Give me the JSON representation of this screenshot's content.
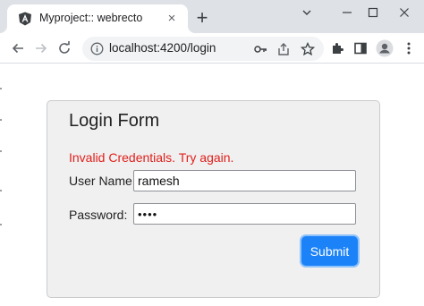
{
  "browser": {
    "tab": {
      "title": "Myproject:: webrecto",
      "close_glyph": "×"
    },
    "new_tab_glyph": "+",
    "window_controls": {
      "chevron": "⌄",
      "minimize": "—",
      "maximize": "☐",
      "close": "✕"
    },
    "omnibox": {
      "url": "localhost:4200/login"
    },
    "icons": [
      "back-icon",
      "forward-icon",
      "reload-icon",
      "info-icon",
      "key-icon",
      "share-icon",
      "star-icon",
      "extensions-icon",
      "side-panel-icon",
      "profile-icon",
      "menu-icon"
    ]
  },
  "login_form": {
    "title": "Login Form",
    "error": "Invalid Credentials. Try again.",
    "username_label": "User Name:",
    "username_value": "ramesh",
    "password_label": "Password:",
    "password_value": "••••",
    "submit_label": "Submit"
  },
  "colors": {
    "error": "#e0201b",
    "submit_bg": "#1b82f8",
    "panel_bg": "#f0f0f1",
    "tabstrip_bg": "#dee1e6"
  }
}
